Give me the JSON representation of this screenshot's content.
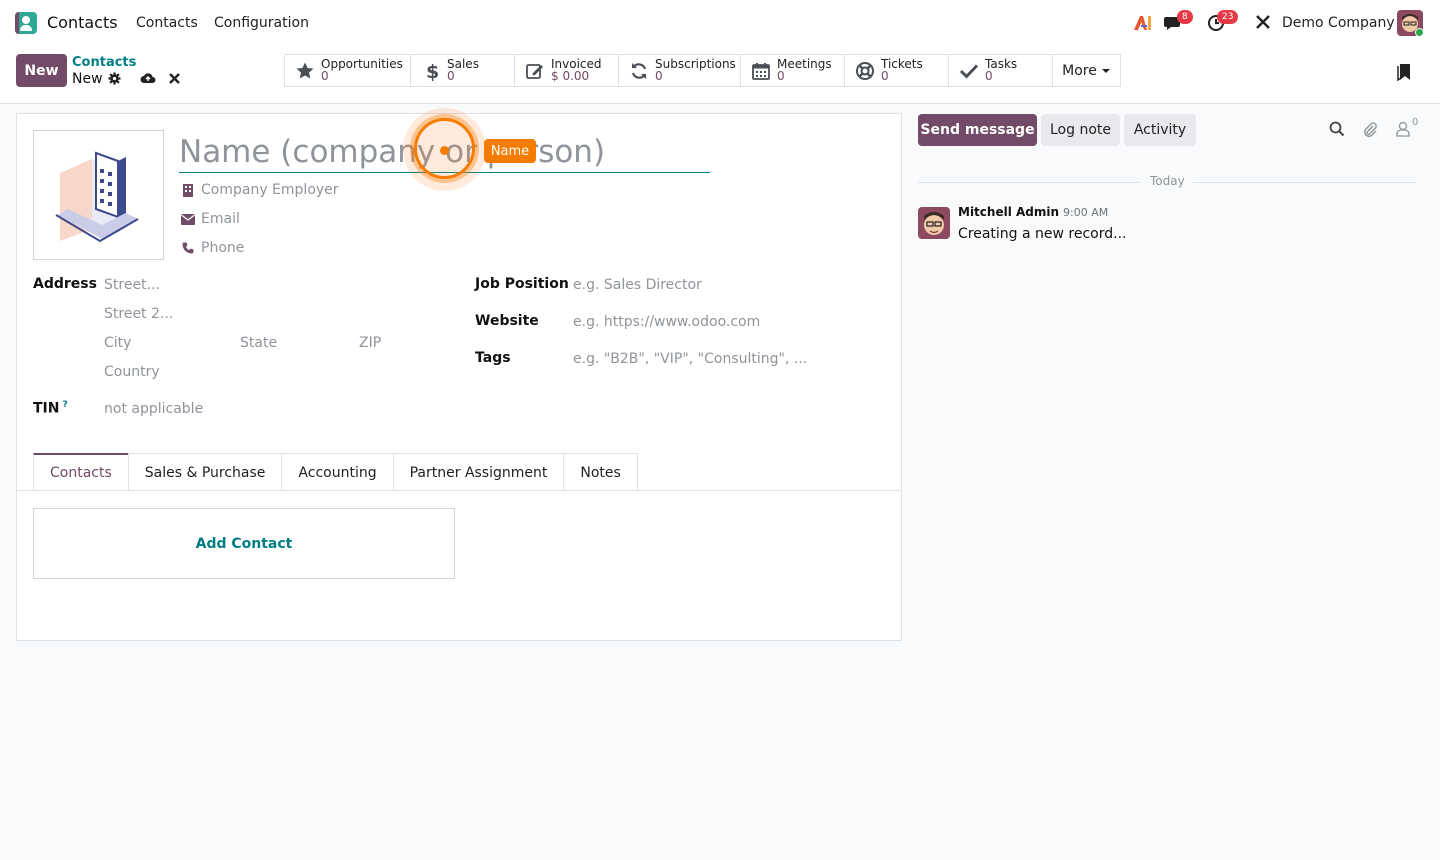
{
  "navbar": {
    "app_name": "Contacts",
    "menu": [
      "Contacts",
      "Configuration"
    ],
    "messages_badge": "8",
    "activities_badge": "23",
    "company": "Demo Company"
  },
  "control": {
    "new_label": "New",
    "breadcrumb": "Contacts",
    "record_name": "New",
    "smart_buttons": [
      {
        "label": "Opportunities",
        "value": "0"
      },
      {
        "label": "Sales",
        "value": "0"
      },
      {
        "label": "Invoiced",
        "value": "$ 0.00"
      },
      {
        "label": "Subscriptions",
        "value": "0"
      },
      {
        "label": "Meetings",
        "value": "0"
      },
      {
        "label": "Tickets",
        "value": "0"
      },
      {
        "label": "Tasks",
        "value": "0"
      }
    ],
    "more_label": "More"
  },
  "form": {
    "name_placeholder": "Name (company or person)",
    "company_placeholder": "Company Employer",
    "email_placeholder": "Email",
    "phone_placeholder": "Phone",
    "address_label": "Address",
    "street_placeholder": "Street...",
    "street2_placeholder": "Street 2...",
    "city_placeholder": "City",
    "state_placeholder": "State",
    "zip_placeholder": "ZIP",
    "country_placeholder": "Country",
    "tin_label": "TIN",
    "tin_help": "?",
    "tin_placeholder": "not applicable",
    "job_label": "Job Position",
    "job_placeholder": "e.g. Sales Director",
    "website_label": "Website",
    "website_placeholder": "e.g. https://www.odoo.com",
    "tags_label": "Tags",
    "tags_placeholder": "e.g. \"B2B\", \"VIP\", \"Consulting\", ...",
    "tabs": [
      "Contacts",
      "Sales & Purchase",
      "Accounting",
      "Partner Assignment",
      "Notes"
    ],
    "add_contact": "Add Contact"
  },
  "highlight": {
    "tag": "Name"
  },
  "chatter": {
    "send_message": "Send message",
    "log_note": "Log note",
    "activity": "Activity",
    "followers_count": "0",
    "today": "Today",
    "message": {
      "author": "Mitchell Admin",
      "time": "9:00 AM",
      "body": "Creating a new record..."
    }
  },
  "colors": {
    "primary": "#714b67",
    "accent": "#017e84",
    "highlight": "#f57c00"
  }
}
